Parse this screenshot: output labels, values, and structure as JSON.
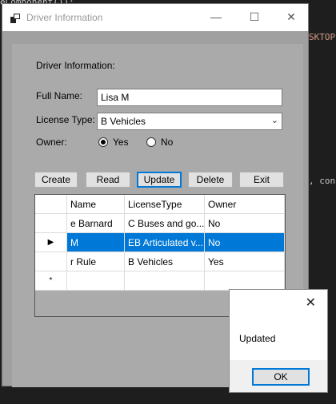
{
  "background": {
    "snippets": [
      "eComponent());",
      "SKTOP",
      ", con"
    ]
  },
  "window": {
    "title": "Driver Information",
    "controls": {
      "minimize": "—",
      "maximize": "☐",
      "close": "✕"
    }
  },
  "form": {
    "heading": "Driver Information:",
    "full_name_label": "Full Name:",
    "full_name_value": "Lisa M",
    "license_type_label": "License Type:",
    "license_type_value": "B Vehicles",
    "owner_label": "Owner:",
    "owner_yes": "Yes",
    "owner_no": "No",
    "owner_selected": "Yes"
  },
  "buttons": {
    "create": "Create",
    "read": "Read",
    "update": "Update",
    "delete": "Delete",
    "exit": "Exit"
  },
  "grid": {
    "columns": [
      "Name",
      "LicenseType",
      "Owner"
    ],
    "rows": [
      {
        "name": "e Barnard",
        "license": "C Buses and go...",
        "owner": "No"
      },
      {
        "name": "M",
        "license": "EB Articulated v...",
        "owner": "No"
      },
      {
        "name": "r Rule",
        "license": "B Vehicles",
        "owner": "Yes"
      }
    ],
    "new_row_marker": "*",
    "selected_row_marker": "▶"
  },
  "message_box": {
    "text": "Updated",
    "ok_label": "OK",
    "close_glyph": "✕"
  }
}
